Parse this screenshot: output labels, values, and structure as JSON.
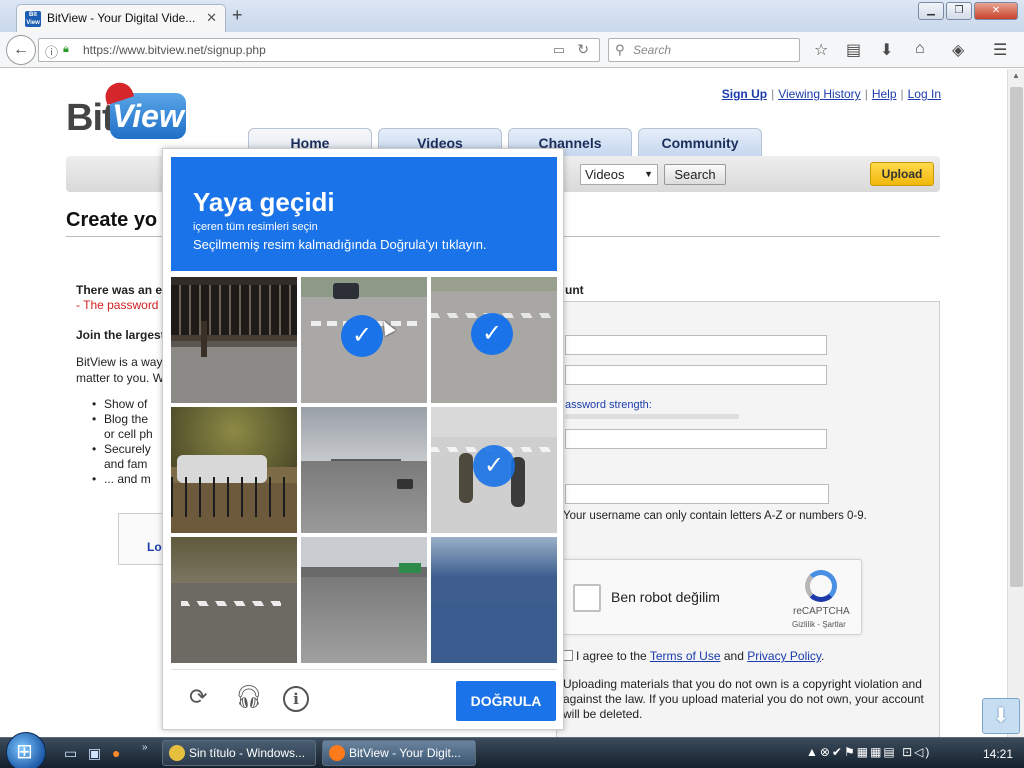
{
  "browser": {
    "tab_title": "BitView - Your Digital Vide...",
    "favicon_text": "Bit View",
    "new_tab_symbol": "+",
    "url": "https://www.bitview.net/signup.php",
    "search_placeholder": "Search"
  },
  "site": {
    "logo_bit": "Bit",
    "logo_view": "View",
    "top_links": [
      "Sign Up",
      "Viewing History",
      "Help",
      "Log In"
    ],
    "nav_tabs": [
      "Home",
      "Videos",
      "Channels",
      "Community"
    ],
    "search_select_value": "Videos",
    "search_button": "Search",
    "upload_button": "Upload",
    "page_title_partial": "Create yo",
    "error_title_partial": "There was an e",
    "error_msg_partial": "- The password",
    "join_partial": "Join the largest",
    "intro_line1_partial": "BitView is a way",
    "intro_line2_partial": "matter to you. W",
    "bullets": [
      "Show of",
      "Blog the",
      "or cell ph",
      "Securely",
      "and fam",
      "... and m"
    ],
    "login_box_label": "Lo",
    "account_heading_partial": "unt",
    "password_strength_label": "assword strength:",
    "username_note": "Your username can only contain letters A-Z or numbers 0-9.",
    "recaptcha": {
      "label": "Ben robot değilim",
      "brand": "reCAPTCHA",
      "links": "Gizlilik - Şartlar"
    },
    "terms": {
      "prefix": "I agree to the",
      "terms_link": "Terms of Use",
      "and": "and",
      "privacy_link": "Privacy Policy",
      "suffix": "."
    },
    "upload_note_lines": [
      "Uploading materials that you do not own is a copyright violation and",
      "against the law. If you upload material you do not own, your account",
      "will be deleted."
    ]
  },
  "captcha": {
    "title": "Yaya geçidi",
    "subtitle_small": "içeren tüm resimleri seçin",
    "subtitle": "Seçilmemiş resim kalmadığında Doğrula'yı tıklayın.",
    "verify_button": "DOĞRULA",
    "selected_tiles": [
      2,
      3,
      6
    ],
    "tiles": [
      {
        "name": "storefront",
        "selected": false
      },
      {
        "name": "crosswalk-car",
        "selected": true
      },
      {
        "name": "crosswalk-road",
        "selected": true
      },
      {
        "name": "tree-car",
        "selected": false
      },
      {
        "name": "highway-bridge",
        "selected": false
      },
      {
        "name": "cyclists-crosswalk",
        "selected": true
      },
      {
        "name": "crosswalk-corner",
        "selected": false
      },
      {
        "name": "highway-sign",
        "selected": false
      },
      {
        "name": "road-aerial",
        "selected": false
      }
    ]
  },
  "taskbar": {
    "buttons": [
      "Sin título - Windows...",
      "BitView - Your Digit..."
    ],
    "clock": "14:21"
  }
}
